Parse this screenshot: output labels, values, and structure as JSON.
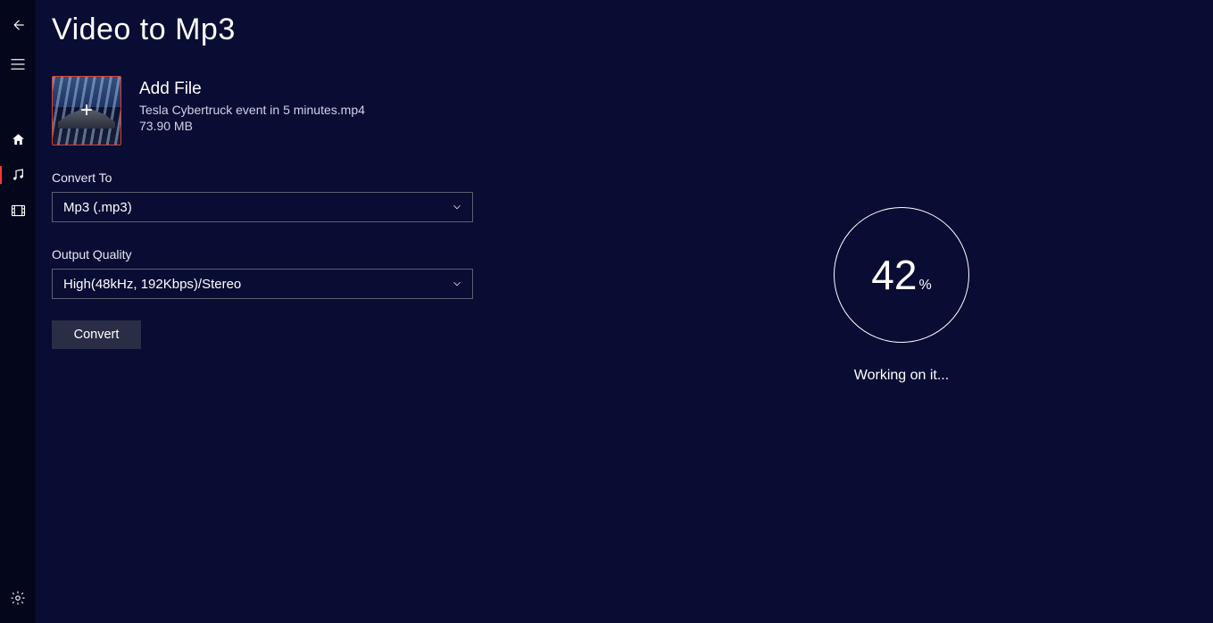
{
  "page": {
    "title": "Video to Mp3"
  },
  "file": {
    "add_label": "Add File",
    "name": "Tesla Cybertruck event in 5 minutes.mp4",
    "size": "73.90 MB"
  },
  "fields": {
    "convert_label": "Convert To",
    "convert_value": "Mp3 (.mp3)",
    "quality_label": "Output Quality",
    "quality_value": "High(48kHz, 192Kbps)/Stereo"
  },
  "actions": {
    "convert": "Convert"
  },
  "progress": {
    "percent": "42",
    "percent_symbol": "%",
    "status": "Working on it..."
  },
  "sidebar": {
    "icons": {
      "back": "back-icon",
      "menu": "menu-icon",
      "home": "home-icon",
      "music": "music-icon",
      "video": "video-icon",
      "settings": "settings-icon"
    }
  }
}
